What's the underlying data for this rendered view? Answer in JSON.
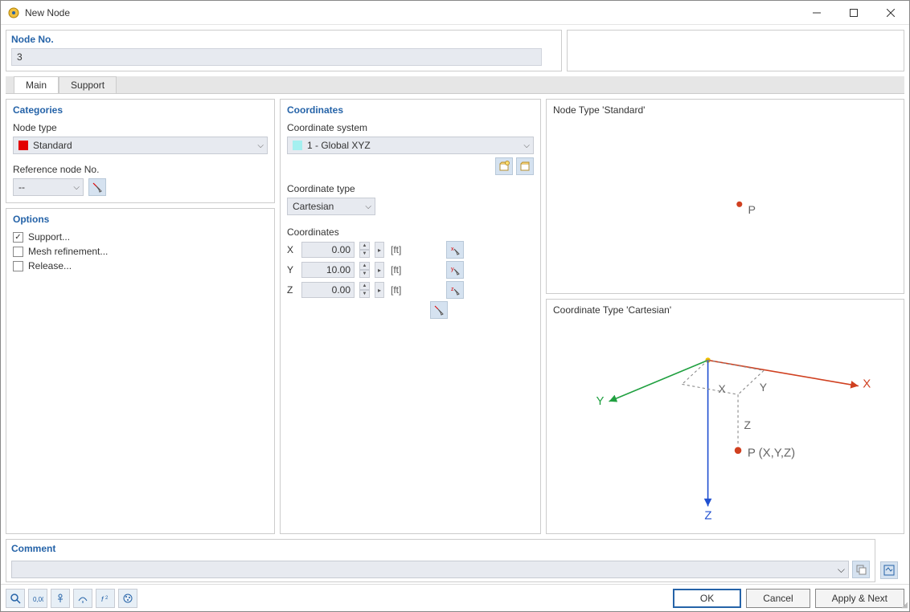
{
  "window": {
    "title": "New Node"
  },
  "node_no": {
    "label": "Node No.",
    "value": "3"
  },
  "tabs": {
    "main": "Main",
    "support": "Support"
  },
  "categories": {
    "title": "Categories",
    "node_type_label": "Node type",
    "node_type_value": "Standard",
    "ref_label": "Reference node No.",
    "ref_value": "--"
  },
  "options": {
    "title": "Options",
    "support": "Support...",
    "mesh": "Mesh refinement...",
    "release": "Release..."
  },
  "coordinates": {
    "title": "Coordinates",
    "system_label": "Coordinate system",
    "system_value": "1 - Global XYZ",
    "type_label": "Coordinate type",
    "type_value": "Cartesian",
    "coord_label": "Coordinates",
    "x_label": "X",
    "x_value": "0.00",
    "y_label": "Y",
    "y_value": "10.00",
    "z_label": "Z",
    "z_value": "0.00",
    "unit": "[ft]"
  },
  "preview": {
    "standard_title": "Node Type 'Standard'",
    "cartesian_title": "Coordinate Type 'Cartesian'",
    "p_label": "P",
    "x_ax": "X",
    "y_ax": "Y",
    "z_ax": "Z",
    "xs": "X",
    "ys": "Y",
    "zs": "Z",
    "pxyz": "P (X,Y,Z)"
  },
  "comment": {
    "title": "Comment"
  },
  "footer": {
    "ok": "OK",
    "cancel": "Cancel",
    "apply": "Apply & Next"
  }
}
